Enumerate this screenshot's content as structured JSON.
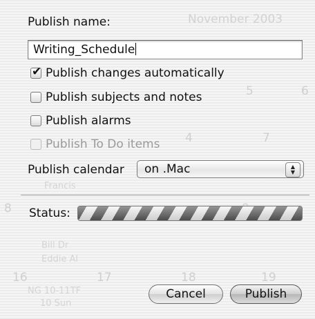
{
  "dialog": {
    "name_label": "Publish name:",
    "name_value": "Writing_Schedule",
    "options": [
      {
        "label": "Publish changes automatically",
        "checked": true,
        "enabled": true
      },
      {
        "label": "Publish subjects and notes",
        "checked": false,
        "enabled": true
      },
      {
        "label": "Publish alarms",
        "checked": false,
        "enabled": true
      },
      {
        "label": "Publish To Do items",
        "checked": false,
        "enabled": false
      }
    ],
    "calendar_label": "Publish calendar",
    "calendar_value": "on .Mac",
    "status_label": "Status:",
    "status_progress": "indeterminate",
    "cancel_label": "Cancel",
    "publish_label": "Publish"
  },
  "background": {
    "month_title": "November 2003",
    "day_numbers": [
      "5",
      "6",
      "4",
      "7",
      "8",
      "9",
      "16",
      "17",
      "18",
      "19"
    ],
    "snippets": [
      "Francis",
      "Bill Dr",
      "Eddie Al",
      "NG 10-11TF",
      "10 Sun"
    ]
  },
  "icons": {
    "checkmark": "checkmark-icon",
    "popup_arrows": "updown-arrows-icon"
  }
}
